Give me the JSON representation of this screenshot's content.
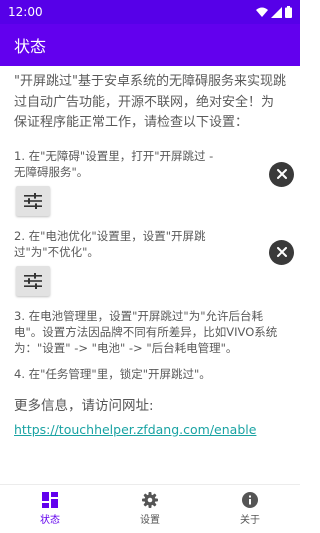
{
  "status_bar": {
    "time": "12:00"
  },
  "app_bar": {
    "title": "状态"
  },
  "intro": "\"开屏跳过\"基于安卓系统的无障碍服务来实现跳过自动广告功能，开源不联网，绝对安全！为保证程序能正常工作，请检查以下设置：",
  "steps": [
    {
      "text": "1. 在\"无障碍\"设置里，打开\"开屏跳过 - 无障碍服务\"。"
    },
    {
      "text": "2. 在\"电池优化\"设置里，设置\"开屏跳过\"为\"不优化\"。"
    },
    {
      "text": "3. 在电池管理里，设置\"开屏跳过\"为\"允许后台耗电\"。设置方法因品牌不同有所差异，比如VIVO系统为：\"设置\" -> \"电池\" -> \"后台耗电管理\"。"
    },
    {
      "text": "4. 在\"任务管理\"里，锁定\"开屏跳过\"。"
    }
  ],
  "more_info": "更多信息，请访问网址:",
  "link": "https://touchhelper.zfdang.com/enable",
  "bottom_nav": {
    "items": [
      {
        "label": "状态",
        "icon": "dashboard-icon"
      },
      {
        "label": "设置",
        "icon": "gear-icon"
      },
      {
        "label": "关于",
        "icon": "info-icon"
      }
    ],
    "active_color": "#6200ee"
  },
  "colors": {
    "app_bar": "#6200ee",
    "status_bar": "#5600e8",
    "link": "#1aa3a3"
  }
}
